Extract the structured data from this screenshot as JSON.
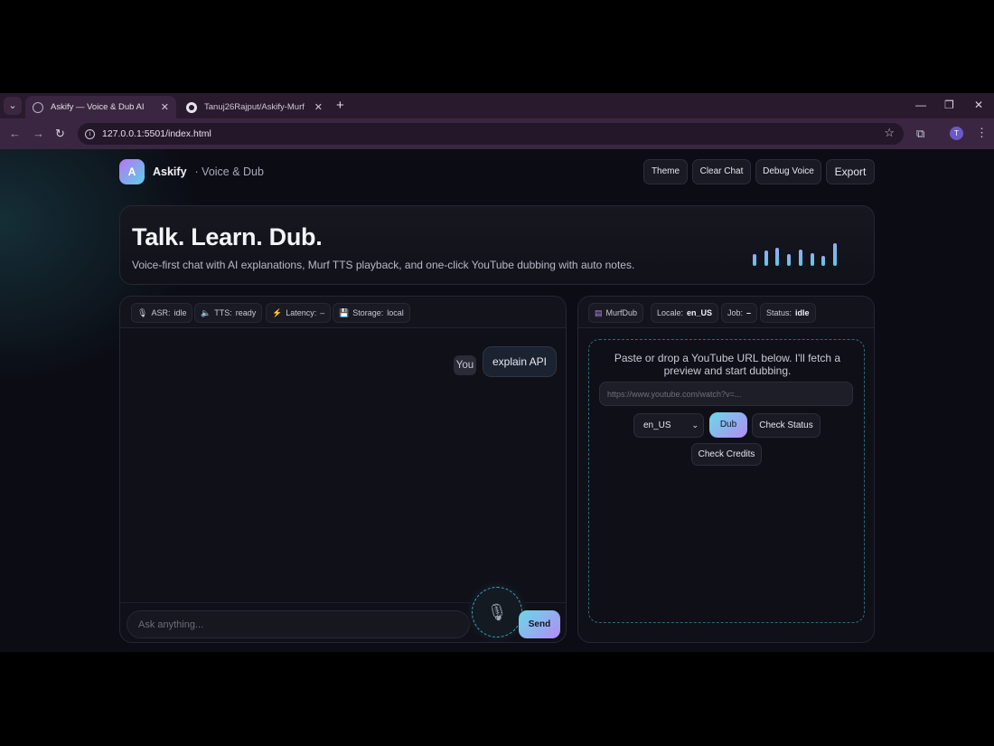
{
  "browser": {
    "tabs": [
      {
        "title": "Askify — Voice & Dub AI",
        "close": "✕"
      },
      {
        "title": "Tanuj26Rajput/Askify-Murf",
        "close": "✕"
      }
    ],
    "new_tab": "+",
    "url": "127.0.0.1:5501/index.html",
    "profile_initial": "T",
    "window_controls": {
      "minimize": "—",
      "restore": "❐",
      "close": "✕"
    }
  },
  "header": {
    "logo_letter": "A",
    "brand": "Askify",
    "subtitle": "· Voice & Dub",
    "buttons": {
      "theme": "Theme",
      "clear_chat": "Clear Chat",
      "debug_voice": "Debug Voice",
      "export": "Export"
    }
  },
  "hero": {
    "title": "Talk. Learn. Dub.",
    "subtitle": "Voice-first chat with AI explanations, Murf TTS playback, and one-click YouTube dubbing with auto notes.",
    "equalizer_levels": [
      0.45,
      0.6,
      0.7,
      0.45,
      0.65,
      0.5,
      0.4,
      0.9
    ]
  },
  "chat": {
    "status": {
      "asr": {
        "label": "ASR:",
        "value": "idle"
      },
      "tts": {
        "label": "TTS:",
        "value": "ready"
      },
      "latency": {
        "label": "Latency:",
        "value": "–"
      },
      "storage": {
        "label": "Storage:",
        "value": "local"
      }
    },
    "messages": [
      {
        "sender": "You",
        "text": "explain API"
      }
    ],
    "input_placeholder": "Ask anything...",
    "send_label": "Send"
  },
  "dub": {
    "status": {
      "brand": "MurfDub",
      "locale": {
        "label": "Locale:",
        "value": "en_US"
      },
      "job": {
        "label": "Job:",
        "value": "–"
      },
      "state": {
        "label": "Status:",
        "value": "idle"
      }
    },
    "instructions": "Paste or drop a YouTube URL below. I'll fetch a preview and start dubbing.",
    "url_placeholder": "https://www.youtube.com/watch?v=...",
    "locale_selected": "en_US",
    "dub_label": "Dub",
    "check_status_label": "Check Status",
    "check_credits_label": "Check Credits"
  },
  "icons": [
    "globe-icon",
    "github-icon",
    "info-icon",
    "star-icon",
    "puzzle-icon",
    "mic-icon",
    "speaker-icon",
    "bolt-icon",
    "floppy-icon",
    "chevron-down-icon"
  ],
  "colors": {
    "accent_start": "#6ad8e8",
    "accent_end": "#b28cf4",
    "background": "#0b0c14"
  }
}
